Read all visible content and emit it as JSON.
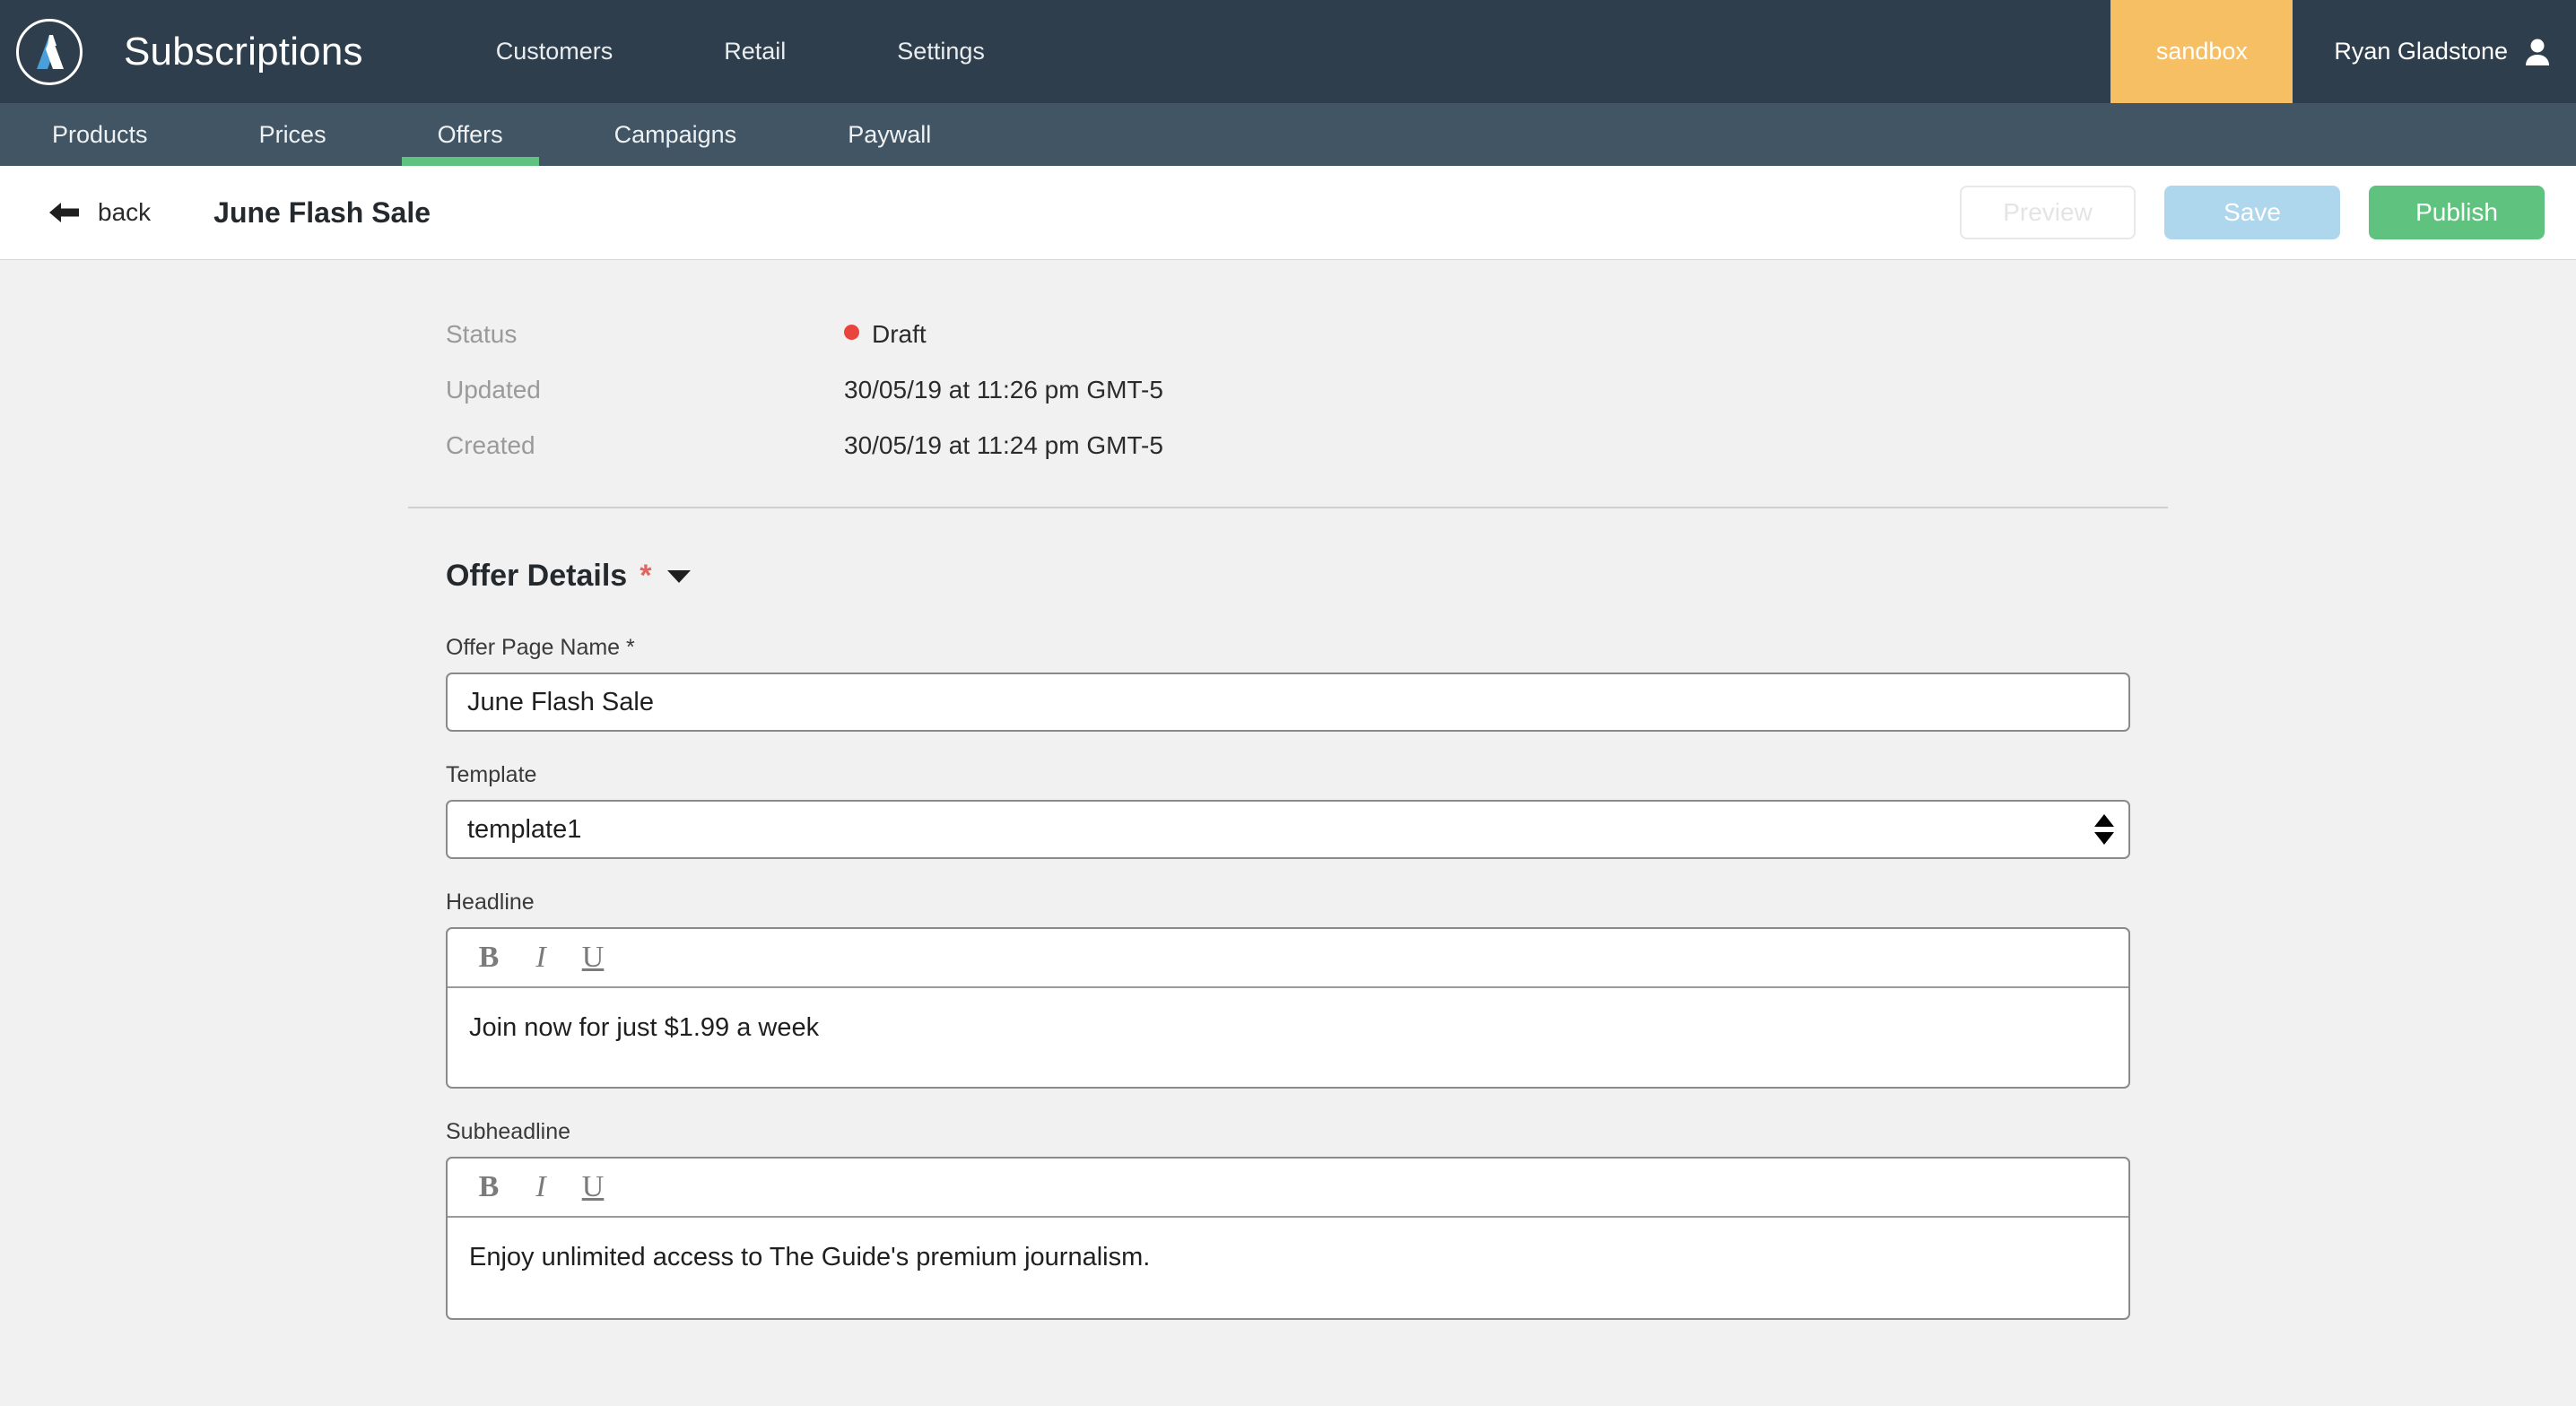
{
  "topnav": {
    "logo_icon": "atex-a-logo-icon",
    "brand": "Subscriptions",
    "links": [
      {
        "label": "Customers"
      },
      {
        "label": "Retail"
      },
      {
        "label": "Settings"
      }
    ],
    "env_badge": "sandbox",
    "user_name": "Ryan Gladstone",
    "user_icon": "user-avatar-icon",
    "colors": {
      "bar": "#2f3e4c",
      "badge": "#f7bf63"
    }
  },
  "subnav": {
    "items": [
      {
        "label": "Products",
        "active": false
      },
      {
        "label": "Prices",
        "active": false
      },
      {
        "label": "Offers",
        "active": true
      },
      {
        "label": "Campaigns",
        "active": false
      },
      {
        "label": "Paywall",
        "active": false
      }
    ],
    "active_color": "#5fc37f",
    "bar_color": "#415565"
  },
  "titlebar": {
    "back_label": "back",
    "back_icon": "arrow-left-icon",
    "title": "June Flash Sale",
    "buttons": {
      "preview": "Preview",
      "save": "Save",
      "publish": "Publish"
    },
    "colors": {
      "save": "#aed7ee",
      "publish": "#5fc37f"
    }
  },
  "meta": {
    "rows": [
      {
        "label": "Status",
        "value": "Draft",
        "dot": true,
        "dot_color": "#e8453c"
      },
      {
        "label": "Updated",
        "value": "30/05/19 at 11:26 pm GMT-5",
        "dot": false
      },
      {
        "label": "Created",
        "value": "30/05/19 at 11:24 pm GMT-5",
        "dot": false
      }
    ]
  },
  "offer_details": {
    "section_title": "Offer Details",
    "required_marker": "*",
    "caret_icon": "chevron-down-icon",
    "fields": {
      "offer_page_name": {
        "label": "Offer Page Name *",
        "value": "June Flash Sale",
        "placeholder": ""
      },
      "template": {
        "label": "Template",
        "value": "template1",
        "options": [
          "template1"
        ]
      },
      "headline": {
        "label": "Headline",
        "value": "Join now for just $1.99 a week",
        "toolbar": {
          "bold": "B",
          "italic": "I",
          "underline": "U"
        }
      },
      "subheadline": {
        "label": "Subheadline",
        "value": "Enjoy unlimited access to The Guide's premium journalism.",
        "toolbar": {
          "bold": "B",
          "italic": "I",
          "underline": "U"
        }
      }
    }
  }
}
